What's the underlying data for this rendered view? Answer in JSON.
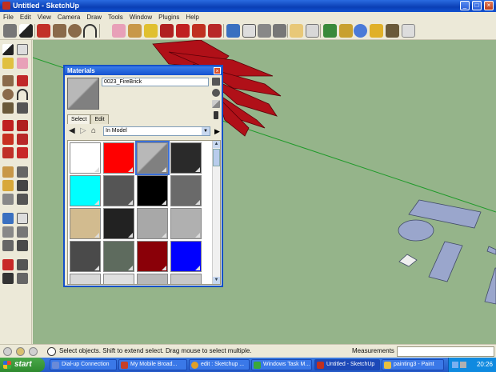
{
  "window": {
    "title": "Untitled - SketchUp",
    "controls": [
      "_",
      "□",
      "×"
    ]
  },
  "menu": [
    "File",
    "Edit",
    "View",
    "Camera",
    "Draw",
    "Tools",
    "Window",
    "Plugins",
    "Help"
  ],
  "materials": {
    "title": "Materials",
    "close": "×",
    "material_name": "0023_FireBrick",
    "tabs": [
      "Select",
      "Edit"
    ],
    "nav": {
      "back": "◀",
      "forward": "▷",
      "home": "⌂",
      "library": "In Model",
      "dropdown": "▼",
      "details": "▶"
    },
    "swatches": [
      "#ffffff",
      "#ff0000",
      "#9c9c9c",
      "#2a2a2a",
      "#00ffff",
      "#555555",
      "#000000",
      "#6a6a6a",
      "#d2bb8f",
      "#222222",
      "#a8a8a8",
      "#b0b0b0",
      "#4a4a4a",
      "#5e6b5e",
      "#8a0008",
      "#0000ff",
      "#d8d8d8",
      "#e0e0e0",
      "#b8b8b8",
      "#c8c8c8"
    ],
    "selected_index": 2,
    "scroll": {
      "up": "▲",
      "down": "▼"
    }
  },
  "status": {
    "text": "Select objects. Shift to extend select. Drag mouse to select multiple.",
    "measurements_label": "Measurements",
    "measurements_value": ""
  },
  "taskbar": {
    "start": "start",
    "tasks": [
      "Dial-up Connection",
      "My Mobile Broad...",
      "edit : Sketchup ...",
      "Windows Task M...",
      "Untitled - SketchUp",
      "painting3 - Paint"
    ],
    "active_index": 4,
    "clock": "20:26"
  },
  "colors": {
    "viewport": "#95b48a",
    "model_red": "#b01018",
    "shapes": "#9aa6cc"
  }
}
